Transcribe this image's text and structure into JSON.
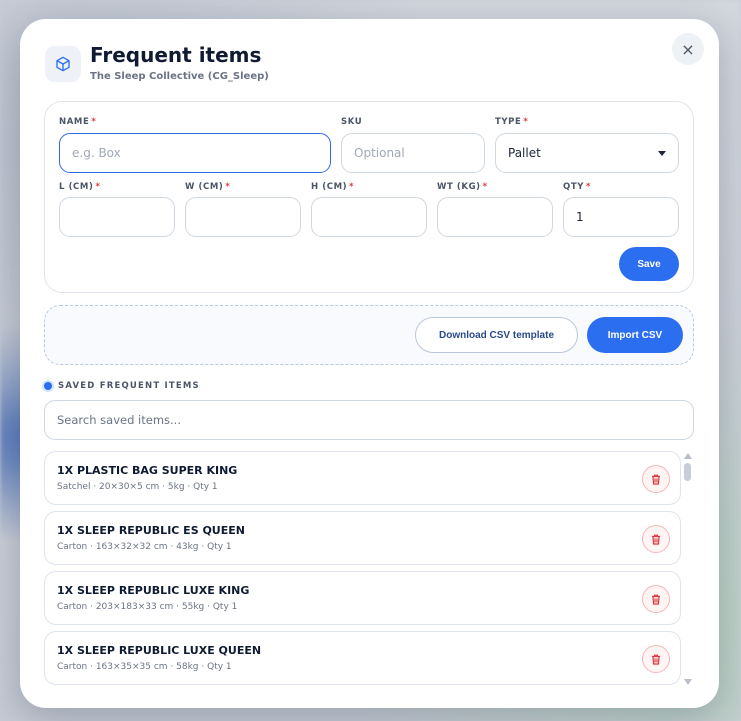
{
  "modal": {
    "title": "Frequent items",
    "subtitle": "The Sleep Collective (CG_Sleep)",
    "close_icon": "×"
  },
  "form": {
    "name": {
      "label": "NAME",
      "required_mark": "*",
      "placeholder": "e.g. Box",
      "value": ""
    },
    "sku": {
      "label": "SKU",
      "placeholder": "Optional",
      "value": ""
    },
    "type": {
      "label": "TYPE",
      "required_mark": "*",
      "value": "Pallet"
    },
    "length": {
      "label": "L (CM)",
      "required_mark": "*",
      "value": ""
    },
    "width": {
      "label": "W (CM)",
      "required_mark": "*",
      "value": ""
    },
    "height": {
      "label": "H (CM)",
      "required_mark": "*",
      "value": ""
    },
    "weight": {
      "label": "WT (KG)",
      "required_mark": "*",
      "value": ""
    },
    "qty": {
      "label": "QTY",
      "required_mark": "*",
      "value": "1"
    },
    "save_label": "Save"
  },
  "csv": {
    "download_label": "Download CSV template",
    "import_label": "Import CSV"
  },
  "saved": {
    "section_title": "SAVED FREQUENT ITEMS",
    "search_placeholder": "Search saved items...",
    "items": [
      {
        "name": "1X PLASTIC BAG SUPER KING",
        "meta": "Satchel · 20×30×5 cm · 5kg · Qty 1"
      },
      {
        "name": "1X SLEEP REPUBLIC ES QUEEN",
        "meta": "Carton · 163×32×32 cm · 43kg · Qty 1"
      },
      {
        "name": "1X SLEEP REPUBLIC LUXE KING",
        "meta": "Carton · 203×183×33 cm · 55kg · Qty 1"
      },
      {
        "name": "1X SLEEP REPUBLIC LUXE QUEEN",
        "meta": "Carton · 163×35×35 cm · 58kg · Qty 1"
      }
    ]
  },
  "colors": {
    "accent": "#2b6ef0",
    "danger": "#e0383e",
    "title": "#0f1a33"
  }
}
